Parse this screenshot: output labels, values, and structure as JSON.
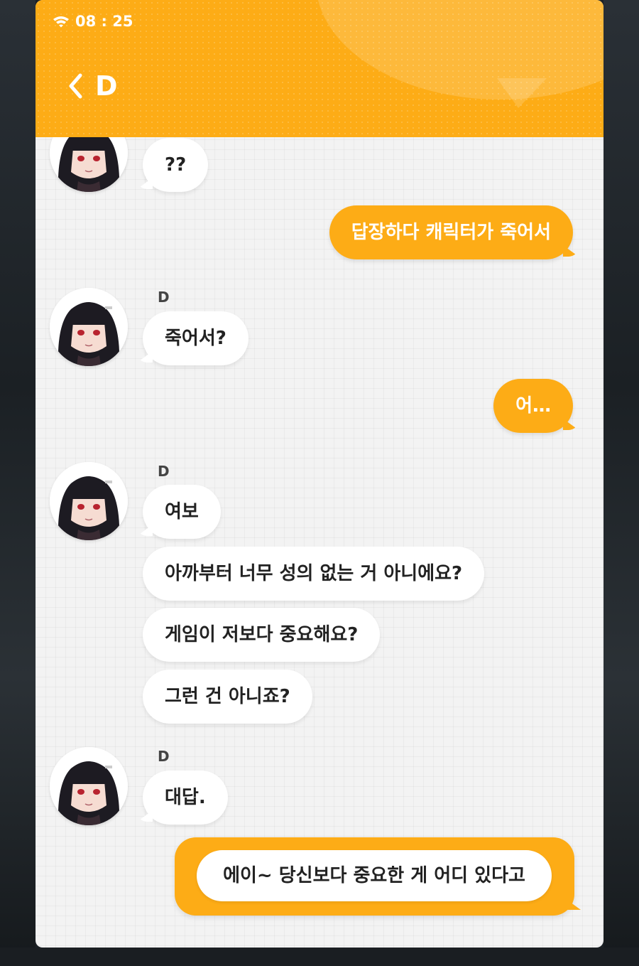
{
  "status_bar": {
    "time": "08 : 25"
  },
  "header": {
    "title": "D"
  },
  "contact": {
    "name": "D"
  },
  "messages": [
    {
      "from": "contact",
      "text": "??"
    },
    {
      "from": "me",
      "text": "답장하다 캐릭터가 죽어서"
    },
    {
      "from": "contact",
      "sender": "D",
      "text": "죽어서?"
    },
    {
      "from": "me",
      "text": "어…"
    },
    {
      "from": "contact",
      "sender": "D",
      "text": "여보"
    },
    {
      "from": "contact",
      "text": "아까부터 너무 성의 없는 거 아니에요?"
    },
    {
      "from": "contact",
      "text": "게임이 저보다 중요해요?"
    },
    {
      "from": "contact",
      "text": "그런 건 아니죠?"
    },
    {
      "from": "contact",
      "sender": "D",
      "text": "대답."
    }
  ],
  "reply_options": [
    "에이~ 당신보다 중요한 게 어디 있다고"
  ],
  "colors": {
    "accent": "#fdac16",
    "bubble_in": "#ffffff",
    "chat_bg": "#f3f3f3"
  },
  "icons": {
    "back": "chevron-left-icon",
    "wifi": "wifi-icon"
  }
}
